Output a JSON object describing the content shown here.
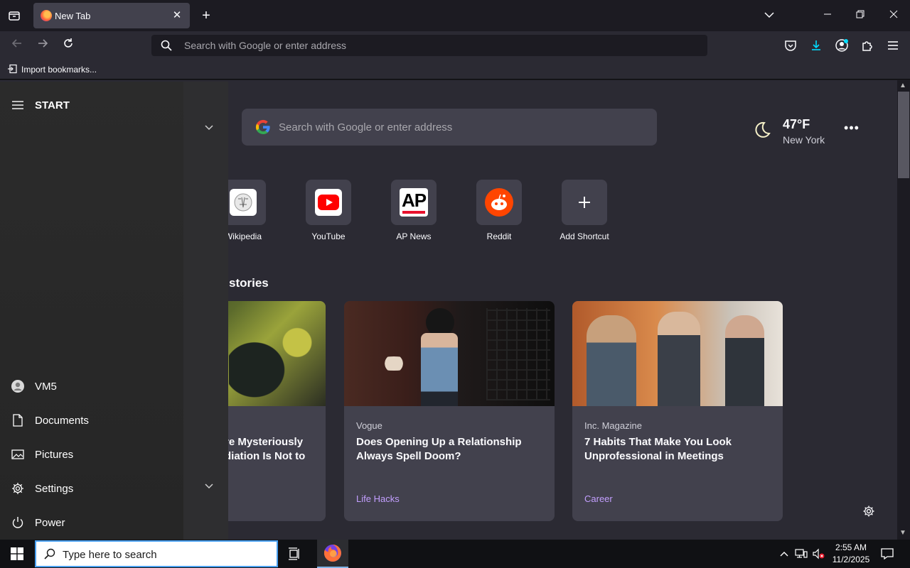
{
  "browser": {
    "tab_title": "New Tab",
    "url_placeholder": "Search with Google or enter address",
    "bookmarks_import_label": "Import bookmarks..."
  },
  "newtab": {
    "search_placeholder": "Search with Google or enter address",
    "weather": {
      "temperature": "47°F",
      "city": "New York"
    },
    "shortcuts": [
      {
        "label": "Wikipedia",
        "icon": "wikipedia-icon"
      },
      {
        "label": "YouTube",
        "icon": "youtube-icon"
      },
      {
        "label": "AP News",
        "icon": "ap-news-icon"
      },
      {
        "label": "Reddit",
        "icon": "reddit-icon"
      },
      {
        "label": "Add Shortcut",
        "icon": "plus-icon"
      }
    ],
    "stories_heading": "stories",
    "stories": [
      {
        "source": "",
        "headline": "re Mysteriously\ndiation Is Not to",
        "category": ""
      },
      {
        "source": "Vogue",
        "headline": "Does Opening Up a Relationship Always Spell Doom?",
        "category": "Life Hacks"
      },
      {
        "source": "Inc. Magazine",
        "headline": "7 Habits That Make You Look Unprofessional in Meetings",
        "category": "Career"
      }
    ]
  },
  "start_menu": {
    "title": "START",
    "items": [
      {
        "label": "VM5",
        "icon": "user-icon"
      },
      {
        "label": "Documents",
        "icon": "document-icon"
      },
      {
        "label": "Pictures",
        "icon": "pictures-icon"
      },
      {
        "label": "Settings",
        "icon": "gear-icon"
      },
      {
        "label": "Power",
        "icon": "power-icon"
      }
    ]
  },
  "taskbar": {
    "search_placeholder": "Type here to search",
    "time": "2:55 AM",
    "date": "11/2/2025"
  },
  "colors": {
    "accent_purple": "#c39fff",
    "tab_bg": "#42414d",
    "content_bg": "#2b2a33",
    "taskbar_search_border": "#4aa0f0"
  }
}
